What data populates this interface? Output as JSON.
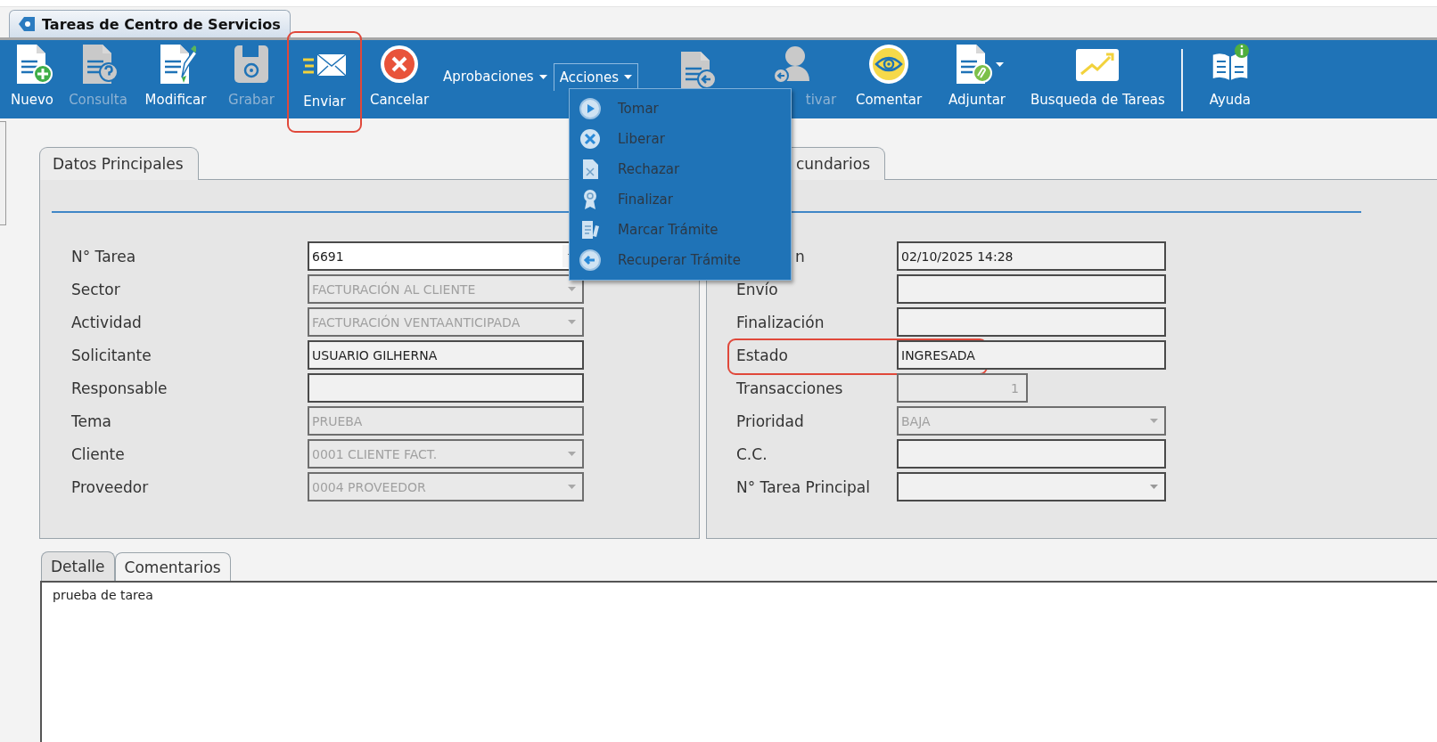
{
  "window": {
    "tab_title": "Tareas de Centro de Servicios"
  },
  "toolbar": [
    {
      "kind": "button",
      "label": "Nuevo",
      "disabled": false,
      "highlighted": false
    },
    {
      "kind": "button",
      "label": "Consulta",
      "disabled": true,
      "highlighted": false
    },
    {
      "kind": "button",
      "label": "Modificar",
      "disabled": false,
      "highlighted": false
    },
    {
      "kind": "button",
      "label": "Grabar",
      "disabled": true,
      "highlighted": false
    },
    {
      "kind": "button",
      "label": "Enviar",
      "disabled": false,
      "highlighted": true
    },
    {
      "kind": "button",
      "label": "Cancelar",
      "disabled": false,
      "highlighted": false
    },
    {
      "kind": "dropdown",
      "label": "Aprobaciones",
      "expanded": false
    },
    {
      "kind": "dropdown",
      "label": "Acciones",
      "expanded": true
    },
    {
      "kind": "icon_only"
    },
    {
      "kind": "button",
      "label": "tivar",
      "disabled": true,
      "highlighted": false
    },
    {
      "kind": "button",
      "label": "Comentar",
      "disabled": false,
      "highlighted": false
    },
    {
      "kind": "split",
      "label": "Adjuntar",
      "disabled": false,
      "highlighted": false
    },
    {
      "kind": "button",
      "label": "Busqueda de Tareas",
      "disabled": false,
      "highlighted": false
    },
    {
      "kind": "separator"
    },
    {
      "kind": "button",
      "label": "Ayuda",
      "disabled": false,
      "highlighted": false
    }
  ],
  "actions_menu": [
    "Tomar",
    "Liberar",
    "Rechazar",
    "Finalizar",
    "Marcar Trámite",
    "Recuperar Trámite"
  ],
  "main_panel": {
    "tab": "Datos Principales",
    "fields": [
      {
        "label": "N° Tarea",
        "kind": "combo",
        "value": "6691",
        "disabled": false,
        "highlighted": false
      },
      {
        "label": "Sector",
        "kind": "combo",
        "value": "FACTURACIÓN AL CLIENTE",
        "disabled": true,
        "highlighted": false
      },
      {
        "label": "Actividad",
        "kind": "combo",
        "value": "FACTURACIÓN VENTAANTICIPADA",
        "disabled": true,
        "highlighted": false
      },
      {
        "label": "Solicitante",
        "kind": "text",
        "value": "USUARIO GILHERNA",
        "disabled": false,
        "highlighted": false
      },
      {
        "label": "Responsable",
        "kind": "text",
        "disabled": false,
        "highlighted": false
      },
      {
        "label": "Tema",
        "kind": "text",
        "value": "PRUEBA",
        "disabled": true,
        "highlighted": false
      },
      {
        "label": "Cliente",
        "kind": "combo",
        "value": "0001 CLIENTE FACT.",
        "disabled": true,
        "highlighted": false
      },
      {
        "label": "Proveedor",
        "kind": "combo",
        "value": "0004 PROVEEDOR",
        "disabled": true,
        "highlighted": false
      }
    ]
  },
  "secondary_panel": {
    "tab": "cundarios",
    "fields": [
      {
        "label": "n",
        "kind": "text",
        "value": "02/10/2025 14:28",
        "disabled": false,
        "highlighted": false
      },
      {
        "label": "Envío",
        "kind": "text",
        "disabled": false,
        "highlighted": false
      },
      {
        "label": "Finalización",
        "kind": "text",
        "disabled": false,
        "highlighted": false
      },
      {
        "label": "Estado",
        "kind": "text",
        "value": "INGRESADA",
        "disabled": false,
        "highlighted": true
      },
      {
        "label": "Transacciones",
        "kind": "number",
        "value": "1",
        "disabled": true,
        "highlighted": false
      },
      {
        "label": "Prioridad",
        "kind": "combo",
        "value": "BAJA",
        "disabled": true,
        "highlighted": false
      },
      {
        "label": "C.C.",
        "kind": "text",
        "disabled": false,
        "highlighted": false
      },
      {
        "label": "N° Tarea Principal",
        "kind": "combo",
        "disabled": false,
        "highlighted": false
      }
    ]
  },
  "detail_tabs": [
    {
      "label": "Detalle",
      "selected": true
    },
    {
      "label": "Comentarios",
      "selected": false
    }
  ],
  "detail_text": "prueba de tarea"
}
